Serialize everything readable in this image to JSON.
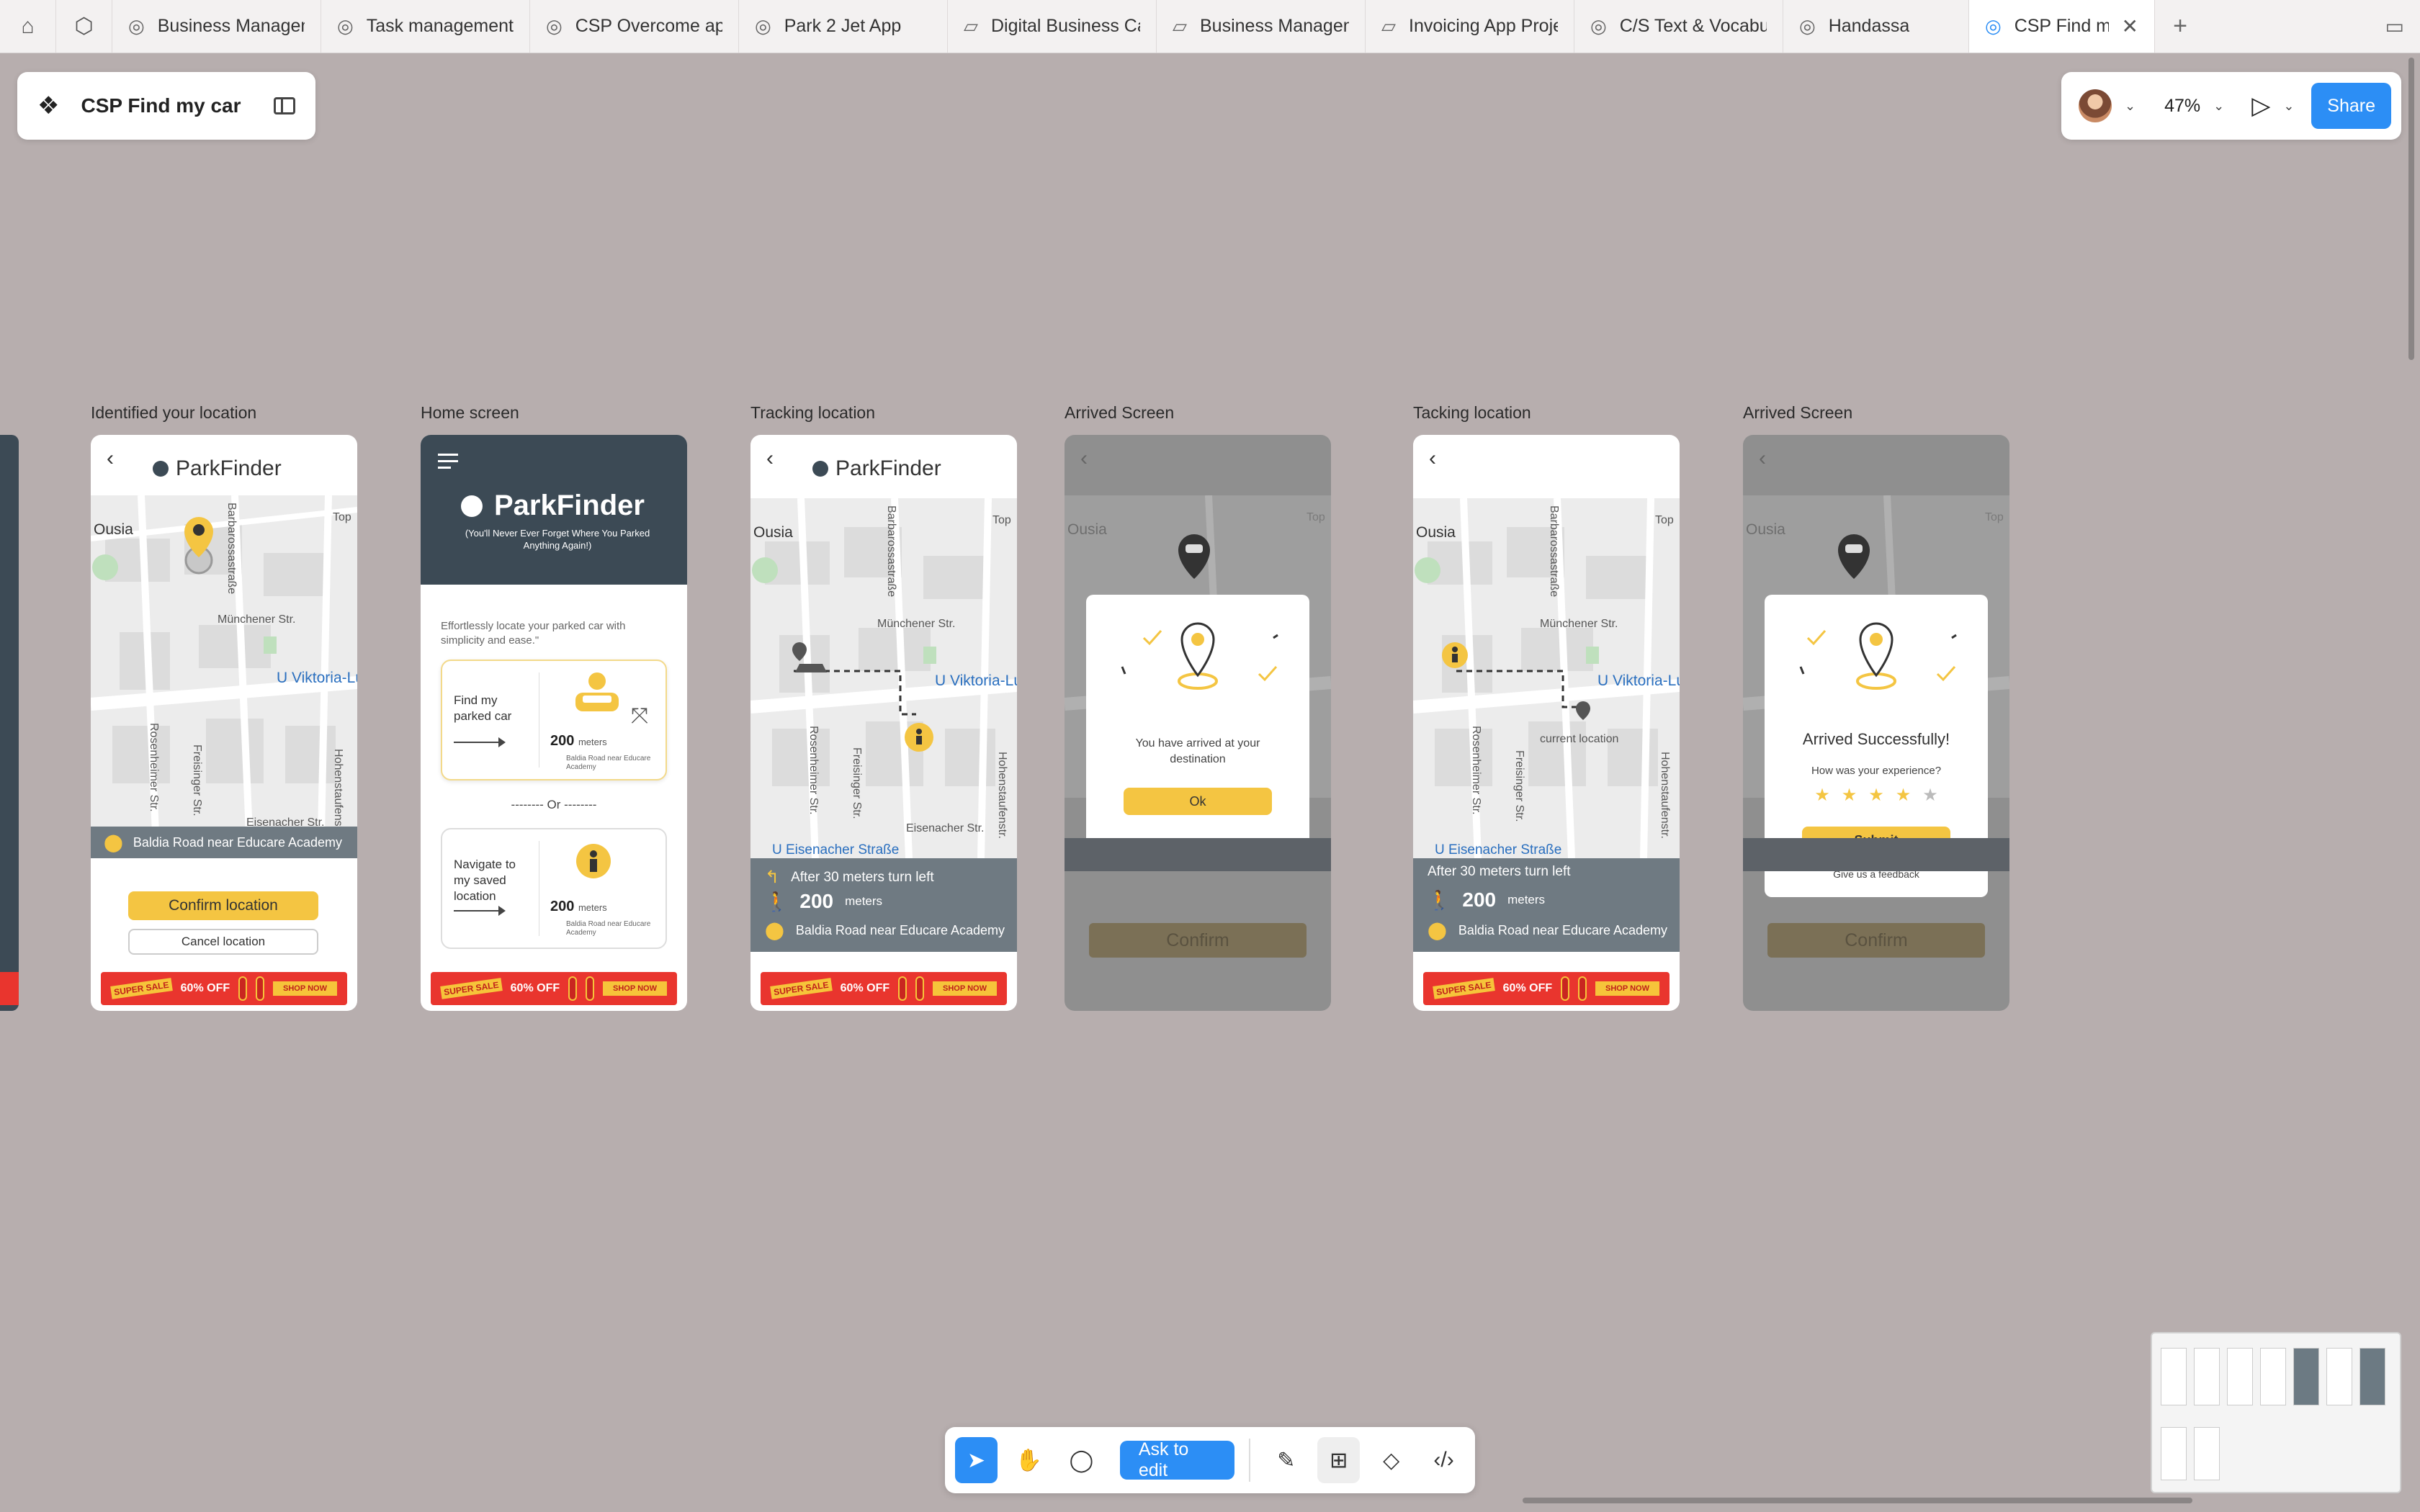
{
  "tabs": [
    {
      "label": "Business Managem",
      "icon": "◎"
    },
    {
      "label": "Task management",
      "icon": "◎"
    },
    {
      "label": "CSP Overcome ap",
      "icon": "◎"
    },
    {
      "label": "Park 2 Jet App",
      "icon": "◎"
    },
    {
      "label": "Digital Business Ca",
      "icon": "▱"
    },
    {
      "label": "Business Managem",
      "icon": "▱"
    },
    {
      "label": "Invoicing App Proje",
      "icon": "▱"
    },
    {
      "label": "C/S Text & Vocabu",
      "icon": "◎"
    },
    {
      "label": "Handassa",
      "icon": "◎"
    },
    {
      "label": "CSP Find my c",
      "icon": "◎",
      "active": true
    }
  ],
  "file": {
    "name": "CSP Find my car"
  },
  "header": {
    "zoom": "47%",
    "share_label": "Share"
  },
  "frames": {
    "f1_label": "Identified your location",
    "f2_label": "Home screen",
    "f3_label": "Tracking location",
    "f4_label": "Arrived Screen",
    "f5_label": "Tacking location",
    "f6_label": "Arrived Screen"
  },
  "app": {
    "brand": "ParkFinder",
    "tagline": "(You'll Never Ever Forget Where You Parked Anything Again!)",
    "home_desc": "Effortlessly locate your parked car with simplicity and ease.\"",
    "find_car": "Find my parked car",
    "navigate_saved": "Navigate to my saved location",
    "or": "-------- Or --------",
    "distance": "200",
    "meters": "meters",
    "address": "Baldia Road near Educare Academy",
    "address_small": "Baldia Road near Educare Academy",
    "confirm_location": "Confirm location",
    "cancel_location": "Cancel location",
    "turn_instruction": "After 30 meters turn left",
    "current_location": "current location",
    "confirm": "Confirm",
    "arrived_text": "You have arrived at your destination",
    "ok": "Ok",
    "arrived_title": "Arrived Successfully!",
    "experience_q": "How was your experience?",
    "submit": "Submit",
    "feedback": "Give us a feedback",
    "rating": 4
  },
  "map": {
    "ousia": "Ousia",
    "top": "Top",
    "barbarossa": "Barbarossastraße",
    "muenchener": "Münchener Str.",
    "viktoria": "U Viktoria-Lu",
    "rosenheimer": "Rosenheimer Str.",
    "freisinger": "Freisinger Str.",
    "hohenstaufen": "Hohenstaufenstr.",
    "eisenacher": "Eisenacher Str.",
    "ueisenacher": "U Eisenacher Straße"
  },
  "banner": {
    "sale": "SUPER SALE",
    "off": "60% OFF",
    "shop": "SHOP NOW"
  },
  "toolbar": {
    "ask_label": "Ask to edit"
  }
}
